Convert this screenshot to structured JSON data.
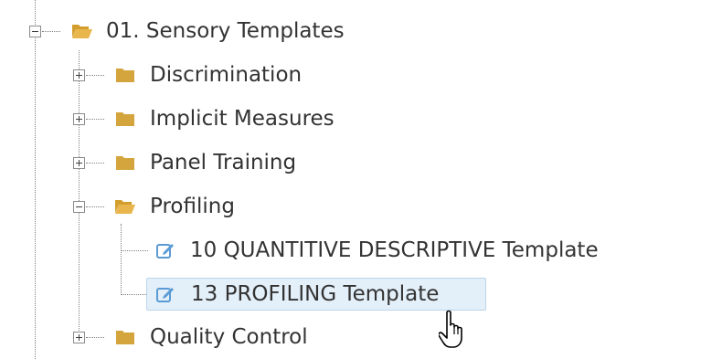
{
  "tree": {
    "root": {
      "label": "01. Sensory Templates",
      "expanded": true
    },
    "children": [
      {
        "label": "Discrimination",
        "expanded": false
      },
      {
        "label": "Implicit Measures",
        "expanded": false
      },
      {
        "label": "Panel Training",
        "expanded": false
      },
      {
        "label": "Profiling",
        "expanded": true,
        "children": [
          {
            "label": "10 QUANTITIVE DESCRIPTIVE Template",
            "selected": false
          },
          {
            "label": "13 PROFILING Template",
            "selected": true
          }
        ]
      },
      {
        "label": "Quality Control",
        "expanded": false
      }
    ]
  },
  "colors": {
    "folder": "#d4a53c",
    "folder_open": "#e6b548",
    "edit_icon": "#5b9bd5",
    "selected_bg": "#e3eff9",
    "selected_border": "#bed5ea",
    "text": "#333333"
  }
}
